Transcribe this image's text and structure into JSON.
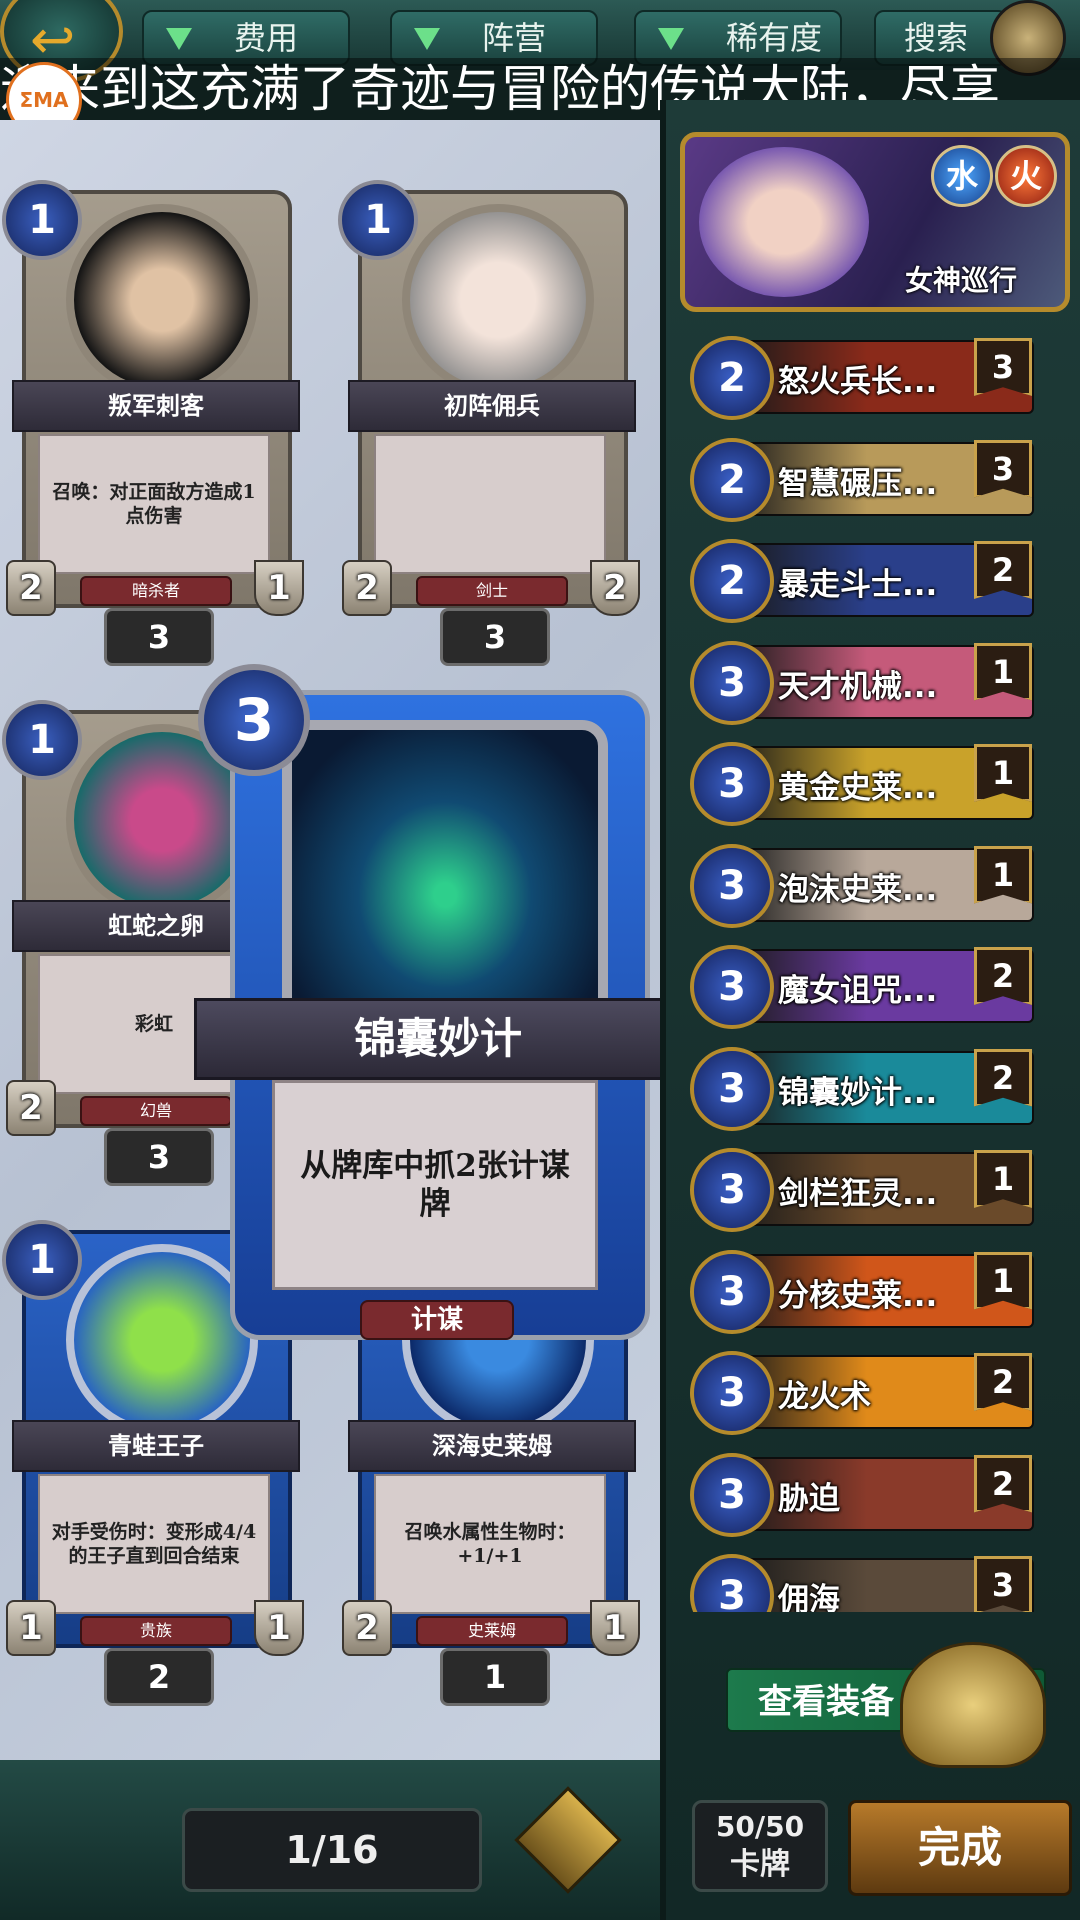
{
  "topbar": {
    "filters": [
      {
        "label": "费用"
      },
      {
        "label": "阵营"
      },
      {
        "label": "稀有度"
      }
    ],
    "search_label": "搜索"
  },
  "marquee_text": "迎来到这充满了奇迹与冒险的传说大陆，尽享",
  "logo_text": "ΣMA",
  "cards": [
    {
      "name": "叛军刺客",
      "cost": "1",
      "text": "召唤：对正面敌方造成1点伤害",
      "attack": "2",
      "health": "1",
      "tribe": "暗杀者",
      "count": "3"
    },
    {
      "name": "初阵佣兵",
      "cost": "1",
      "text": "",
      "attack": "2",
      "health": "2",
      "tribe": "剑士",
      "count": "3"
    },
    {
      "name": "虹蛇之卵",
      "cost": "1",
      "text": "彩虹",
      "attack": "2",
      "health": "",
      "tribe": "幻兽",
      "count": "3"
    },
    {
      "name": "青蛙王子",
      "cost": "1",
      "text": "对手受伤时：变形成4/4的王子直到回合结束",
      "attack": "1",
      "health": "1",
      "tribe": "贵族",
      "count": "2"
    },
    {
      "name": "深海史莱姆",
      "cost": "",
      "text": "召唤水属性生物时：+1/+1",
      "attack": "2",
      "health": "1",
      "tribe": "史莱姆",
      "count": "1"
    }
  ],
  "big_card": {
    "name": "锦囊妙计",
    "cost": "3",
    "text": "从牌库中抓2张计谋牌",
    "tribe": "计谋"
  },
  "pagination": {
    "text": "1/16"
  },
  "hero": {
    "name": "女神巡行",
    "elements": [
      "水",
      "火"
    ]
  },
  "deck": [
    {
      "cost": "2",
      "name": "怒火兵长...",
      "count": "3",
      "color": "#8a2a1a"
    },
    {
      "cost": "2",
      "name": "智慧碾压...",
      "count": "3",
      "color": "#b89a5a"
    },
    {
      "cost": "2",
      "name": "暴走斗士...",
      "count": "2",
      "color": "#2a3f8a"
    },
    {
      "cost": "3",
      "name": "天才机械...",
      "count": "1",
      "color": "#c55a7a"
    },
    {
      "cost": "3",
      "name": "黄金史莱...",
      "count": "1",
      "color": "#c9a22a"
    },
    {
      "cost": "3",
      "name": "泡沫史莱...",
      "count": "1",
      "color": "#b8a89a"
    },
    {
      "cost": "3",
      "name": "魔女诅咒...",
      "count": "2",
      "color": "#6a3aa0"
    },
    {
      "cost": "3",
      "name": "锦囊妙计...",
      "count": "2",
      "color": "#1a8a9a"
    },
    {
      "cost": "3",
      "name": "剑栏狂灵...",
      "count": "1",
      "color": "#6a4a2a"
    },
    {
      "cost": "3",
      "name": "分核史莱...",
      "count": "1",
      "color": "#d0561a"
    },
    {
      "cost": "3",
      "name": "龙火术",
      "count": "2",
      "color": "#e08a1a"
    },
    {
      "cost": "3",
      "name": "胁迫",
      "count": "2",
      "color": "#8a3a2a"
    },
    {
      "cost": "3",
      "name": "佣海",
      "count": "3",
      "color": "#5a4a3a"
    }
  ],
  "equip_label": "查看装备",
  "deck_count": {
    "number": "50/50",
    "label": "卡牌"
  },
  "done_label": "完成"
}
